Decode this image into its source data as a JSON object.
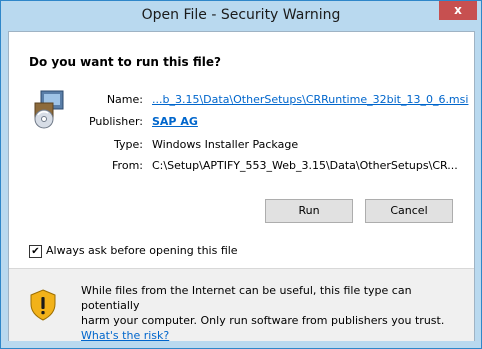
{
  "window": {
    "title": "Open File - Security Warning",
    "close_glyph": "x"
  },
  "dialog": {
    "question": "Do you want to run this file?",
    "fields": {
      "name_label": "Name:",
      "name_value": "...b_3.15\\Data\\OtherSetups\\CRRuntime_32bit_13_0_6.msi",
      "publisher_label": "Publisher:",
      "publisher_value": "SAP AG",
      "type_label": "Type:",
      "type_value": "Windows Installer Package",
      "from_label": "From:",
      "from_value": "C:\\Setup\\APTIFY_553_Web_3.15\\Data\\OtherSetups\\CR..."
    },
    "buttons": {
      "run": "Run",
      "cancel": "Cancel"
    },
    "checkbox": {
      "label": "Always ask before opening this file",
      "checked": true,
      "glyph": "✔"
    },
    "warning": {
      "line1": "While files from the Internet can be useful, this file type can potentially",
      "line2": "harm your computer. Only run software from publishers you trust.",
      "link": "What's the risk?"
    }
  },
  "colors": {
    "border": "#2f87c9",
    "frame": "#b9d9ef",
    "close": "#c75050",
    "link": "#0066cc"
  },
  "icons": [
    "installer-icon",
    "shield-warning-icon",
    "close-icon",
    "checkmark-icon"
  ]
}
